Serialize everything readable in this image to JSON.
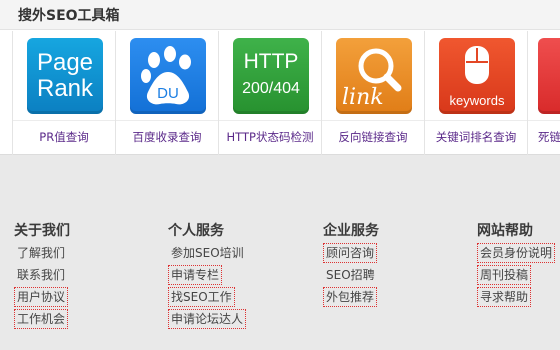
{
  "panel": {
    "title": "搜外SEO工具箱"
  },
  "tools": [
    {
      "id": "pagerank",
      "icon_text": [
        "Page",
        "Rank"
      ],
      "label": "PR值查询",
      "color": "#0b8fd0"
    },
    {
      "id": "baidu",
      "icon_text": "DU",
      "label": "百度收录查询",
      "color": "#1c7fe3"
    },
    {
      "id": "http",
      "icon_text": [
        "HTTP",
        "200/404"
      ],
      "label": "HTTP状态码检测",
      "color": "#33a23d"
    },
    {
      "id": "link",
      "icon_text": "link",
      "label": "反向链接查询",
      "color": "#ea8e28"
    },
    {
      "id": "keywords",
      "icon_text": "keywords",
      "label": "关键词排名查询",
      "color": "#e34725"
    },
    {
      "id": "partial",
      "label": "死链",
      "color": "#e33a3a"
    }
  ],
  "footer": {
    "columns": [
      {
        "title": "关于我们",
        "links": [
          {
            "text": "了解我们",
            "dotted": false
          },
          {
            "text": "联系我们",
            "dotted": false
          },
          {
            "text": "用户协议",
            "dotted": true
          },
          {
            "text": "工作机会",
            "dotted": true
          }
        ]
      },
      {
        "title": "个人服务",
        "links": [
          {
            "text": "参加SEO培训",
            "dotted": false
          },
          {
            "text": "申请专栏",
            "dotted": true
          },
          {
            "text": "找SEO工作",
            "dotted": true
          },
          {
            "text": "申请论坛达人",
            "dotted": true
          }
        ]
      },
      {
        "title": "企业服务",
        "links": [
          {
            "text": "顾问咨询",
            "dotted": true
          },
          {
            "text": "SEO招聘",
            "dotted": false
          },
          {
            "text": "外包推荐",
            "dotted": true
          }
        ]
      },
      {
        "title": "网站帮助",
        "links": [
          {
            "text": "会员身份说明",
            "dotted": true
          },
          {
            "text": "周刊投稿",
            "dotted": true
          },
          {
            "text": "寻求帮助",
            "dotted": true
          }
        ]
      }
    ]
  }
}
